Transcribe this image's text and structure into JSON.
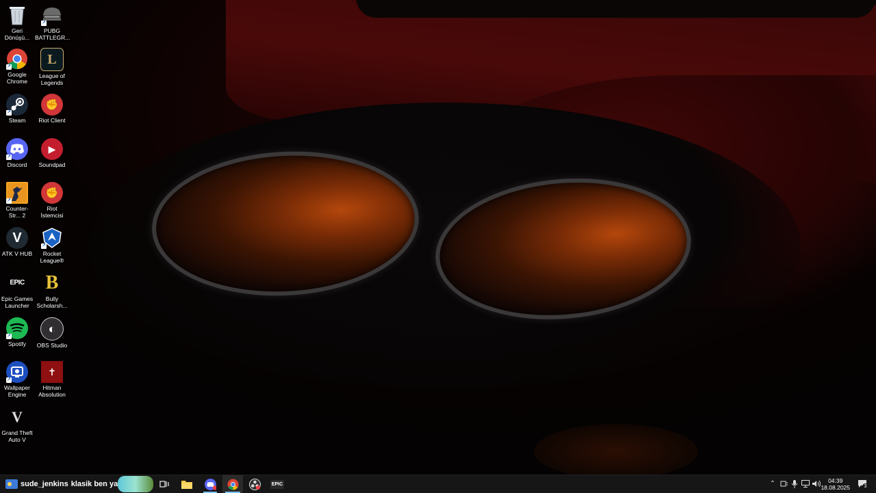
{
  "desktop": {
    "icons": [
      {
        "label": "Geri Dönüşü...",
        "icon": "recycle-bin-icon"
      },
      {
        "label": "PUBG BATTLEGR...",
        "icon": "pubg-icon"
      },
      {
        "label": "Google Chrome",
        "icon": "chrome-icon"
      },
      {
        "label": "League of Legends",
        "icon": "league-of-legends-icon"
      },
      {
        "label": "Steam",
        "icon": "steam-icon"
      },
      {
        "label": "Riot Client",
        "icon": "riot-client-icon"
      },
      {
        "label": "Discord",
        "icon": "discord-icon"
      },
      {
        "label": "Soundpad",
        "icon": "soundpad-icon"
      },
      {
        "label": "Counter-Str... 2",
        "icon": "counter-strike-icon"
      },
      {
        "label": "Riot İstemcisi",
        "icon": "riot-istemcisi-icon"
      },
      {
        "label": "ATK V HUB",
        "icon": "atk-v-hub-icon"
      },
      {
        "label": "Rocket League®",
        "icon": "rocket-league-icon"
      },
      {
        "label": "Epic Games Launcher",
        "icon": "epic-games-icon"
      },
      {
        "label": "Bully Scholarsh...",
        "icon": "bully-icon"
      },
      {
        "label": "Spotify",
        "icon": "spotify-icon"
      },
      {
        "label": "OBS Studio",
        "icon": "obs-studio-icon"
      },
      {
        "label": "Wallpaper Engine",
        "icon": "wallpaper-engine-icon"
      },
      {
        "label": "Hitman Absolution",
        "icon": "hitman-icon"
      },
      {
        "label": "Grand Theft Auto V",
        "icon": "gta-v-icon"
      }
    ],
    "glyphs": {
      "league": "L",
      "riot": "✊",
      "epic": "EPIC",
      "bully": "B",
      "atk": "V",
      "soundpad": "▶",
      "obs": "◐",
      "hitman": "✝",
      "gta": "V"
    }
  },
  "taskbar": {
    "news_user": "sude_jenkins",
    "news_text": "klasik ben ya",
    "epic_label": "EPIC",
    "time": "04:39",
    "date": "18.08.2025",
    "notification_count": "3"
  }
}
